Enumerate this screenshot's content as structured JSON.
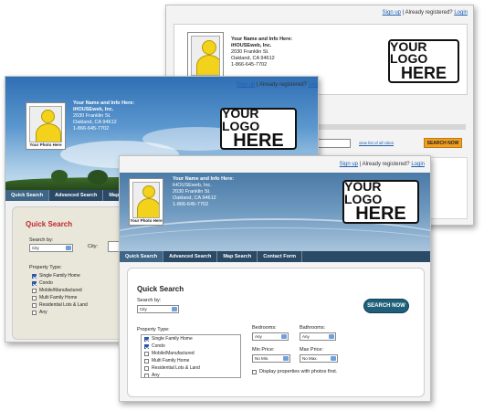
{
  "topbar": {
    "signup": "Sign up",
    "separator": "| Already registered?",
    "login": "Login"
  },
  "agent": {
    "photo_caption": "Your Photo Here",
    "headline": "Your Name and Info Here:",
    "company": "iHOUSEweb, Inc.",
    "street": "2030 Franklin St.",
    "city": "Oakland, CA 94612",
    "phone": "1-866-645-7702"
  },
  "logo": {
    "line1": "YOUR LOGO",
    "line2": "HERE"
  },
  "nav": {
    "quick_search": "Quick Search",
    "advanced_search": "Advanced Search",
    "map_search": "Map Search",
    "map_search_truncated": "Map",
    "contact_form": "Contact Form"
  },
  "back": {
    "view_all": "view list of all cities",
    "search_button": "SEARCH NOW"
  },
  "search": {
    "title": "Quick Search",
    "search_by_label": "Search by:",
    "search_by_value": "City",
    "city_label": "City:",
    "search_button": "SEARCH NOW",
    "property_type_label": "Property Type:",
    "property_types": [
      {
        "label": "Single Family Home",
        "checked": true
      },
      {
        "label": "Condo",
        "checked": true
      },
      {
        "label": "Mobile/Manufactured",
        "checked": false
      },
      {
        "label": "Multi Family Home",
        "checked": false
      },
      {
        "label": "Residential Lots & Land",
        "checked": false
      },
      {
        "label": "Any",
        "checked": false
      }
    ],
    "bedrooms_label": "Bedrooms:",
    "bedrooms_value": "Any",
    "bathrooms_label": "Bathrooms:",
    "bathrooms_value": "Any",
    "min_price_label": "Min Price:",
    "min_price_value": "No Min.",
    "max_price_label": "Max Price:",
    "max_price_value": "No Max.",
    "photos_only_label": "Display properties with photos first."
  },
  "colors": {
    "link": "#1f5fb0",
    "nav_bar": "#2b4a66",
    "nav_active": "#3f6686",
    "search_title_red": "#c0282d",
    "button_teal": "#1f5f7a",
    "button_orange": "#f0a020",
    "photo_yellow": "#f2d21b"
  }
}
